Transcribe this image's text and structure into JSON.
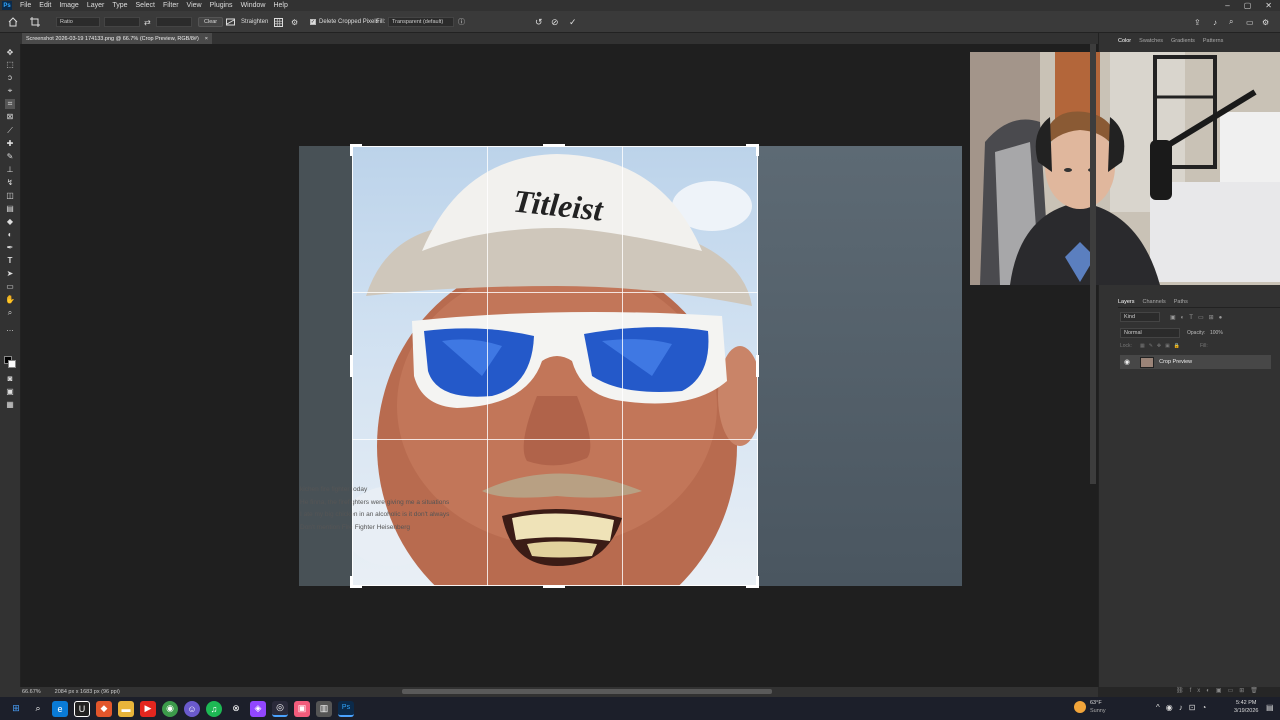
{
  "menubar": {
    "items": [
      "File",
      "Edit",
      "Image",
      "Layer",
      "Type",
      "Select",
      "Filter",
      "View",
      "Plugins",
      "Window",
      "Help"
    ],
    "window_controls": [
      "–",
      "▢",
      "✕"
    ]
  },
  "options_bar": {
    "ratio_label": "Ratio",
    "clear_label": "Clear",
    "straighten_label": "Straighten",
    "delete_cropped_label": "Delete Cropped Pixels",
    "fill_label": "Fill:",
    "fill_value": "Transparent (default)"
  },
  "document": {
    "tab_title": "Screenshot 2026-03-19 174133.png @ 66.7% (Crop Preview, RGB/8#)"
  },
  "image_caption": {
    "lines": [
      "kichen fire fighter today",
      "He finna, the firefighters were giving me a situations",
      "I ate my big chicken in an alcoholic is it don't always and doesn't wake up in right after she's dumb",
      "Don't mention Fire Fighter Heisenberg"
    ]
  },
  "color_panel": {
    "tabs": [
      "Color",
      "Swatches",
      "Gradients",
      "Patterns"
    ]
  },
  "layers_panel": {
    "tabs": [
      "Layers",
      "Channels",
      "Paths"
    ],
    "search_placeholder": "Kind",
    "blend_mode": "Normal",
    "opacity_label": "Opacity:",
    "opacity_value": "100%",
    "lock_label": "Lock:",
    "fill_label": "Fill:",
    "layer_name": "Crop Preview"
  },
  "status_bar": {
    "zoom": "66.67%",
    "doc_info": "2084 px x 1683 px (96 ppi)"
  },
  "taskbar": {
    "weather_temp": "63°F",
    "weather_desc": "Sunny",
    "time": "5:42 PM",
    "date": "3/19/2026"
  },
  "colors": {
    "panel_bg": "#323232",
    "canvas_bg": "#1f1f1f",
    "accent": "#31a8ff"
  }
}
